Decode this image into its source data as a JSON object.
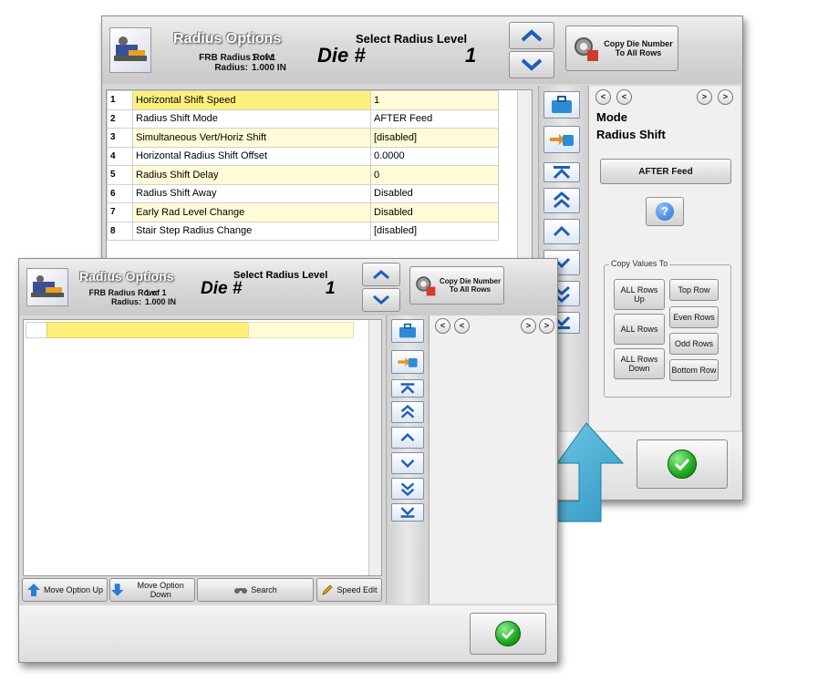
{
  "window": {
    "title": "Radius Options",
    "frb_label": "FRB Radius Row:",
    "frb_value": "1 of 1",
    "radius_label": "Radius:",
    "radius_value": "1.000 IN",
    "select_label": "Select Radius Level",
    "die_label": "Die #",
    "die_value": "1",
    "copy_die_button": "Copy Die Number\nTo All Rows"
  },
  "options_table": [
    {
      "index": "1",
      "name": "Horizontal Shift Speed",
      "value": "1"
    },
    {
      "index": "2",
      "name": "Radius Shift Mode",
      "value": "AFTER Feed"
    },
    {
      "index": "3",
      "name": "Simultaneous Vert/Horiz Shift",
      "value": "[disabled]"
    },
    {
      "index": "4",
      "name": "Horizontal Radius Shift Offset",
      "value": "0.0000"
    },
    {
      "index": "5",
      "name": "Radius Shift Delay",
      "value": "0"
    },
    {
      "index": "6",
      "name": "Radius Shift Away",
      "value": "Disabled"
    },
    {
      "index": "7",
      "name": "Early Rad Level Change",
      "value": "Disabled"
    },
    {
      "index": "8",
      "name": "Stair Step Radius Change",
      "value": "[disabled]"
    }
  ],
  "detail_panel": {
    "nav_left": [
      "<",
      "<"
    ],
    "nav_right": [
      ">",
      ">"
    ],
    "heading_1": "Mode",
    "heading_2": "Radius Shift",
    "value_button": "AFTER Feed",
    "help_icon": "question-icon",
    "copy_values_legend": "Copy Values To",
    "copy_buttons": {
      "all_up": "ALL Rows Up",
      "top": "Top Row",
      "all": "ALL Rows",
      "even": "Even Rows",
      "odd": "Odd Rows",
      "all_down": "ALL Rows Down",
      "bottom": "Bottom Row"
    }
  },
  "bottom_toolbar": {
    "move_up": "Move Option Up",
    "move_down": "Move Option Down",
    "search": "Search",
    "speed_edit": "Speed Edit"
  },
  "colors": {
    "accent_blue": "#1e5fb4",
    "highlight_yellow": "#fdf07a",
    "row_alt_yellow": "#fffbd6",
    "arrow_cyan": "#3aa8cf",
    "ok_green": "#1ea81e"
  }
}
